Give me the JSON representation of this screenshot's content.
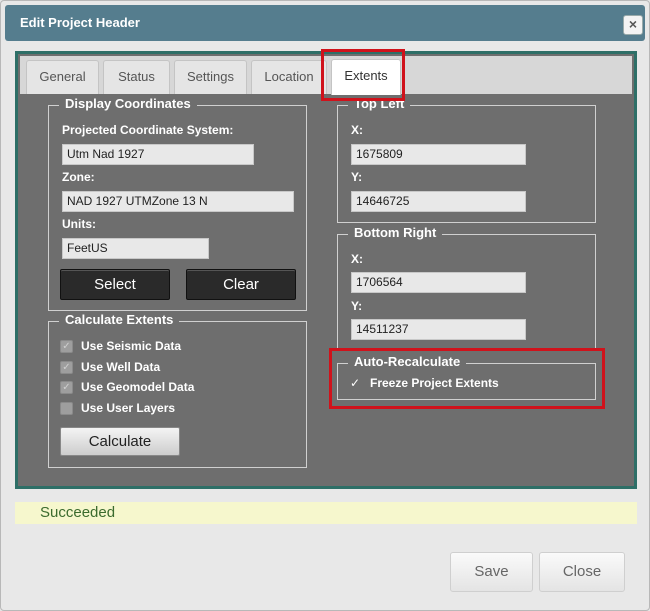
{
  "dialog": {
    "title": "Edit Project Header",
    "close_symbol": "×"
  },
  "tabs": [
    {
      "label": "General"
    },
    {
      "label": "Status"
    },
    {
      "label": "Settings"
    },
    {
      "label": "Location"
    },
    {
      "label": "Extents",
      "active": true
    }
  ],
  "display_coordinates": {
    "legend": "Display Coordinates",
    "pcs_label": "Projected Coordinate System:",
    "pcs_value": "Utm Nad 1927",
    "zone_label": "Zone:",
    "zone_value": "NAD 1927 UTMZone 13 N",
    "units_label": "Units:",
    "units_value": "FeetUS",
    "select_label": "Select",
    "clear_label": "Clear"
  },
  "calculate_extents": {
    "legend": "Calculate Extents",
    "options": [
      {
        "label": "Use Seismic Data",
        "checked": true
      },
      {
        "label": "Use Well Data",
        "checked": true
      },
      {
        "label": "Use Geomodel Data",
        "checked": true
      },
      {
        "label": "Use User Layers",
        "checked": false
      }
    ],
    "calculate_label": "Calculate"
  },
  "top_left": {
    "legend": "Top Left",
    "x_label": "X:",
    "x_value": "1675809",
    "y_label": "Y:",
    "y_value": "14646725"
  },
  "bottom_right": {
    "legend": "Bottom Right",
    "x_label": "X:",
    "x_value": "1706564",
    "y_label": "Y:",
    "y_value": "14511237"
  },
  "auto_recalculate": {
    "legend": "Auto-Recalculate",
    "check_symbol": "✓",
    "freeze_label": "Freeze Project Extents",
    "freeze_checked": true
  },
  "status": {
    "text": "Succeeded"
  },
  "footer": {
    "save_label": "Save",
    "close_label": "Close"
  },
  "colors": {
    "titlebar": "#557d8e",
    "panel_border": "#2e6f67",
    "panel_bg": "#6e6e6e",
    "highlight": "#d0121b",
    "status_bg": "#f6f7cd",
    "status_text": "#3b6b2e"
  }
}
